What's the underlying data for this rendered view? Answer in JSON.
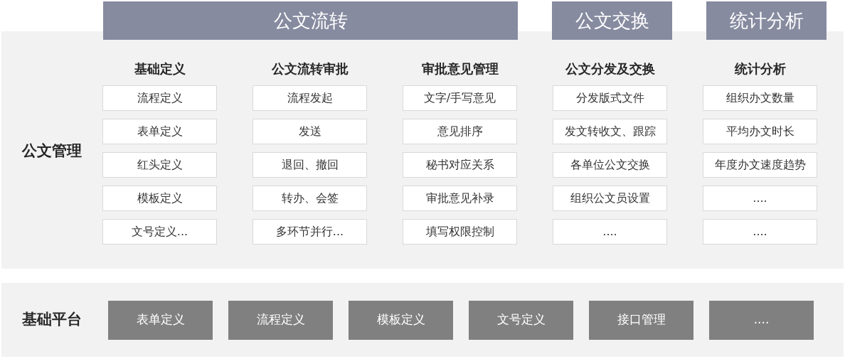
{
  "management": {
    "label": "公文管理",
    "categories": [
      {
        "title": "公文流转",
        "columns": [
          {
            "heading": "基础定义",
            "items": [
              "流程定义",
              "表单定义",
              "红头定义",
              "模板定义",
              "文号定义..."
            ]
          },
          {
            "heading": "公文流转审批",
            "items": [
              "流程发起",
              "发送",
              "退回、撤回",
              "转办、会签",
              "多环节并行..."
            ]
          },
          {
            "heading": "审批意见管理",
            "items": [
              "文字/手写意见",
              "意见排序",
              "秘书对应关系",
              "审批意见补录",
              "填写权限控制"
            ]
          }
        ]
      },
      {
        "title": "公文交换",
        "columns": [
          {
            "heading": "公文分发及交换",
            "items": [
              "分发版式文件",
              "发文转收文、跟踪",
              "各单位公文交换",
              "组织公文员设置",
              "...."
            ]
          }
        ]
      },
      {
        "title": "统计分析",
        "columns": [
          {
            "heading": "统计分析",
            "items": [
              "组织办文数量",
              "平均办文时长",
              "年度办文速度趋势",
              "....",
              "...."
            ]
          }
        ]
      }
    ]
  },
  "platform": {
    "label": "基础平台",
    "items": [
      "表单定义",
      "流程定义",
      "模板定义",
      "文号定义",
      "接口管理",
      "...."
    ]
  }
}
